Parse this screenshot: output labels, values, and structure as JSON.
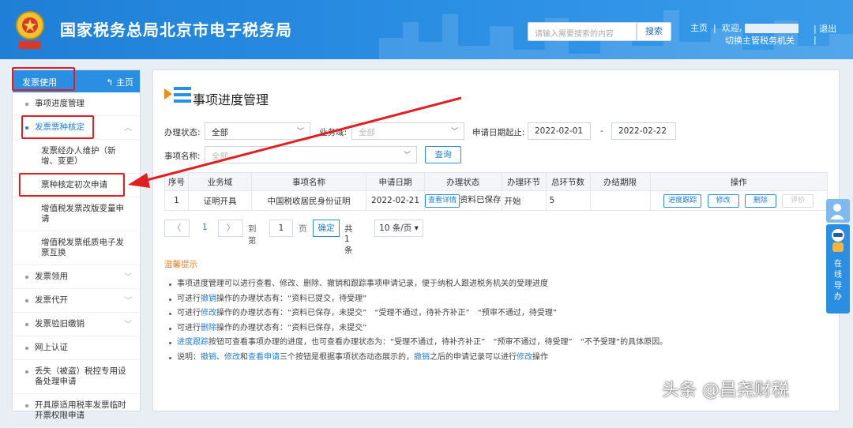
{
  "header": {
    "site_title": "国家税务总局北京市电子税务局",
    "search_placeholder": "请输入需要搜索的内容",
    "search_button": "搜索",
    "home_link": "主页",
    "welcome": "欢迎,",
    "switch_org": "切换主管税务机关",
    "logout": "退出"
  },
  "sidebar": {
    "head_title": "发票使用",
    "head_home": "主页",
    "items": [
      {
        "label": "事项进度管理"
      },
      {
        "label": "发票票种核定"
      },
      {
        "label": "发票领用"
      },
      {
        "label": "发票代开"
      },
      {
        "label": "发票验旧缴销"
      },
      {
        "label": "网上认证"
      },
      {
        "label": "丢失（被盗）税控专用设备处理申请"
      },
      {
        "label": "开具原适用税率发票临时开票权限申请"
      }
    ],
    "sub_items": [
      {
        "label": "发票经办人维护（新增、变更）"
      },
      {
        "label": "票种核定初次申请"
      },
      {
        "label": "增值税发票改版变量申请"
      },
      {
        "label": "增值税发票纸质电子发票互换"
      }
    ]
  },
  "main": {
    "title": "事项进度管理",
    "filters": {
      "status_label": "办理状态:",
      "status_value": "全部",
      "domain_label": "业务域:",
      "domain_value": "全部",
      "date_label": "申请日期起止:",
      "date_from": "2022-02-01",
      "date_sep": "-",
      "date_to": "2022-02-22",
      "item_label": "事项名称:",
      "item_value": "全部",
      "query_button": "查询"
    },
    "table": {
      "headers": [
        "序号",
        "业务域",
        "事项名称",
        "申请日期",
        "办理状态",
        "办理环节",
        "总环节数",
        "办结期限",
        "操作"
      ],
      "rows": [
        {
          "no": "1",
          "domain": "证明开具",
          "name": "中国税收居民身份证明",
          "date": "2022-02-21",
          "detail_btn": "查看详情",
          "status": "资料已保存",
          "stage": "开始",
          "total": "5",
          "deadline": ""
        }
      ],
      "actions": [
        "进度跟踪",
        "修改",
        "删除",
        "评价"
      ]
    },
    "pager": {
      "page_current": "1",
      "goto_label": "到第",
      "goto_value": "1",
      "page_unit": "页",
      "confirm": "确定",
      "total": "共 1 条",
      "page_size": "10 条/页"
    },
    "tips_title": "温馨提示",
    "tips": {
      "t1": "事项进度管理可以进行查看、修改、删除、撤销和跟踪事项申请记录，便于纳税人跟进税务机关的受理进度",
      "t2a": "可进行",
      "t2b": "撤销",
      "t2c": "操作的办理状态有：“资料已提交，待受理”",
      "t3a": "可进行",
      "t3b": "修改",
      "t3c": "操作的办理状态有：“资料已保存，未提交”　“受理不通过，待补齐补正”　“预审不通过，待受理”",
      "t4a": "可进行",
      "t4b": "删除",
      "t4c": "操作的办理状态有：“资料已保存，未提交”",
      "t5a": "进度跟踪",
      "t5b": "按钮可查看事项办理的进度，也可查看办理状态为：“受理不通过，待补齐补正”　“预审不通过，待受理”　“不予受理”的具体原因。",
      "t6a": "说明：",
      "t6b": "撤销",
      "t6c": "、",
      "t6d": "修改",
      "t6e": "和",
      "t6f": "查看申请",
      "t6g": "三个按钮是根据事项状态动态展示的，",
      "t6h": "撤销",
      "t6i": "之后的申请记录可以进行",
      "t6j": "修改",
      "t6k": "操作"
    }
  },
  "float_panel": {
    "chars": [
      "在",
      "线",
      "导",
      "办"
    ]
  },
  "watermark": "头条 @昌尧财税",
  "colors": {
    "brand": "#2a8ee3",
    "highlight": "#e02020",
    "tip": "#e67e22"
  }
}
